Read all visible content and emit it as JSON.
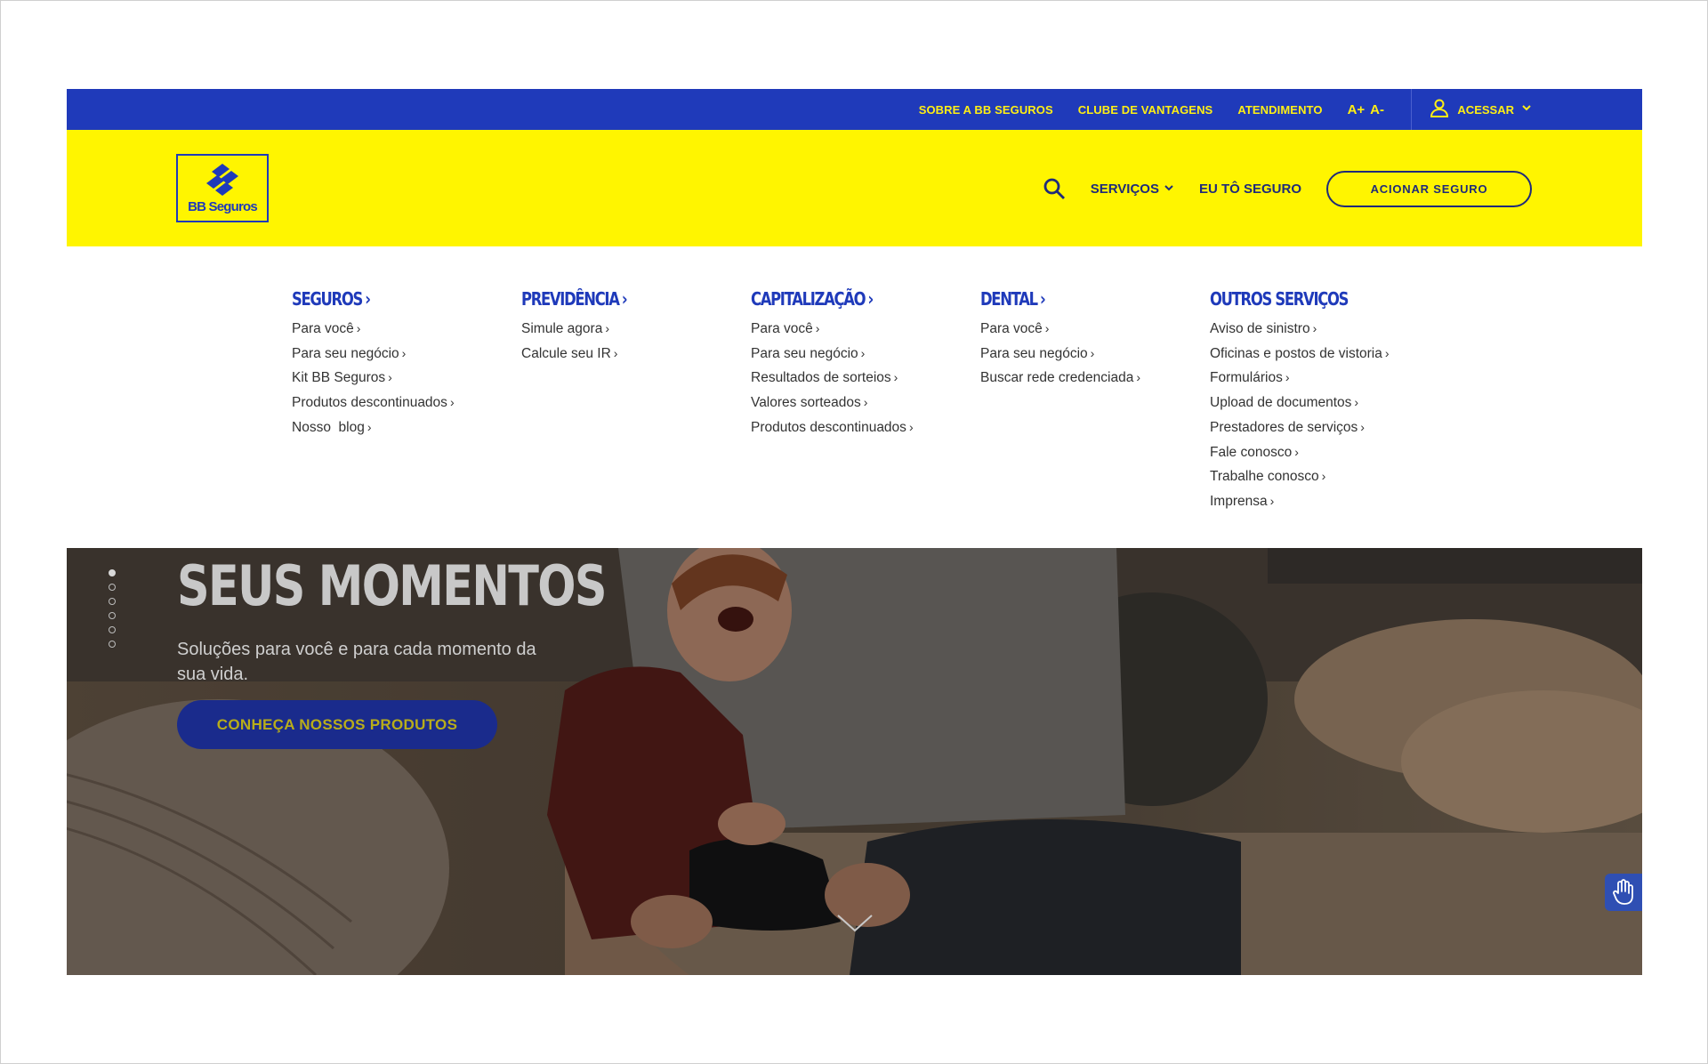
{
  "topbar": {
    "links": [
      "SOBRE A BB SEGUROS",
      "CLUBE DE VANTAGENS",
      "ATENDIMENTO"
    ],
    "font_increase": "A+",
    "font_decrease": "A-",
    "account_label": "ACESSAR",
    "icons": {
      "account": "user-icon",
      "dropdown": "chevron-down-icon"
    }
  },
  "header": {
    "logo_text": "BB Seguros",
    "nav": {
      "services": "SERVIÇOS",
      "eu_to_seguro": "EU TÔ SEGURO"
    },
    "cta": "ACIONAR SEGURO",
    "icons": {
      "search": "search-icon"
    }
  },
  "menu": {
    "columns": [
      {
        "heading": "SEGUROS",
        "has_arrow": true,
        "items": [
          "Para você",
          "Para seu negócio",
          "Kit BB Seguros",
          "Produtos descontinuados",
          "Nosso  blog"
        ]
      },
      {
        "heading": "PREVIDÊNCIA",
        "has_arrow": true,
        "items": [
          "Simule agora",
          "Calcule seu IR"
        ]
      },
      {
        "heading": "CAPITALIZAÇÃO",
        "has_arrow": true,
        "items": [
          "Para você",
          "Para seu negócio",
          "Resultados de sorteios",
          "Valores sorteados",
          "Produtos descontinuados"
        ]
      },
      {
        "heading": "DENTAL",
        "has_arrow": true,
        "items": [
          "Para você",
          "Para seu negócio",
          "Buscar rede credenciada"
        ]
      },
      {
        "heading": "OUTROS SERVIÇOS",
        "has_arrow": false,
        "items": [
          "Aviso de sinistro",
          "Oficinas e postos de vistoria",
          "Formulários",
          "Upload de documentos",
          "Prestadores de serviços",
          "Fale conosco",
          "Trabalhe conosco",
          "Imprensa"
        ]
      }
    ]
  },
  "hero": {
    "title": "SEUS MOMENTOS",
    "subtitle": "Soluções para você e para cada momento da sua vida.",
    "button": "CONHEÇA NOSSOS PRODUTOS",
    "slide_count": 6,
    "active_slide": 1,
    "icons": {
      "scroll": "chevron-down-icon",
      "accessibility": "hand-icon"
    }
  },
  "colors": {
    "brand_blue": "#1f3aba",
    "brand_yellow": "#fff500",
    "link_yellow": "#ffef14",
    "navy": "#1f2a7a"
  }
}
